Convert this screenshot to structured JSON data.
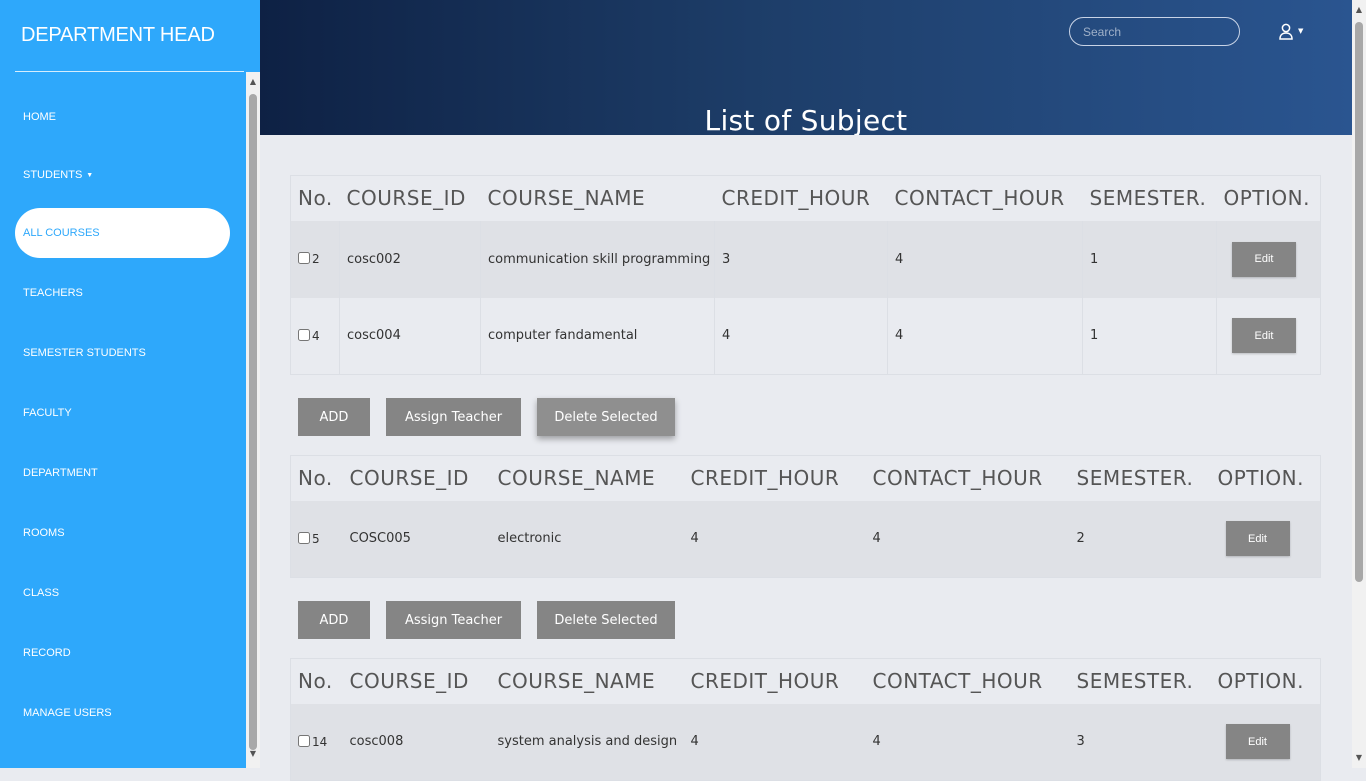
{
  "sidebar": {
    "brand": "DEPARTMENT HEAD",
    "items": [
      {
        "label": "HOME"
      },
      {
        "label": "STUDENTS"
      },
      {
        "label": "ALL COURSES"
      },
      {
        "label": "TEACHERS"
      },
      {
        "label": "SEMESTER STUDENTS"
      },
      {
        "label": "FACULTY"
      },
      {
        "label": "DEPARTMENT"
      },
      {
        "label": "ROOMS"
      },
      {
        "label": "CLASS"
      },
      {
        "label": "RECORD"
      },
      {
        "label": "MANAGE USERS"
      }
    ]
  },
  "header": {
    "search_placeholder": "Search",
    "title": "List of Subject"
  },
  "columns": [
    "No.",
    "COURSE_ID",
    "COURSE_NAME",
    "CREDIT_HOUR",
    "CONTACT_HOUR",
    "SEMESTER.",
    "OPTION."
  ],
  "edit_label": "Edit",
  "buttons": {
    "add": "ADD",
    "assign": "Assign Teacher",
    "delete": "Delete Selected"
  },
  "tables": [
    {
      "rows": [
        {
          "no": "2",
          "course_id": "cosc002",
          "course_name": "communication skill programming",
          "credit": "3",
          "contact": "4",
          "semester": "1"
        },
        {
          "no": "4",
          "course_id": "cosc004",
          "course_name": "computer fandamental",
          "credit": "4",
          "contact": "4",
          "semester": "1"
        }
      ]
    },
    {
      "rows": [
        {
          "no": "5",
          "course_id": "COSC005",
          "course_name": "electronic",
          "credit": "4",
          "contact": "4",
          "semester": "2"
        }
      ]
    },
    {
      "rows": [
        {
          "no": "14",
          "course_id": "cosc008",
          "course_name": "system analysis and design",
          "credit": "4",
          "contact": "4",
          "semester": "3"
        }
      ]
    }
  ]
}
